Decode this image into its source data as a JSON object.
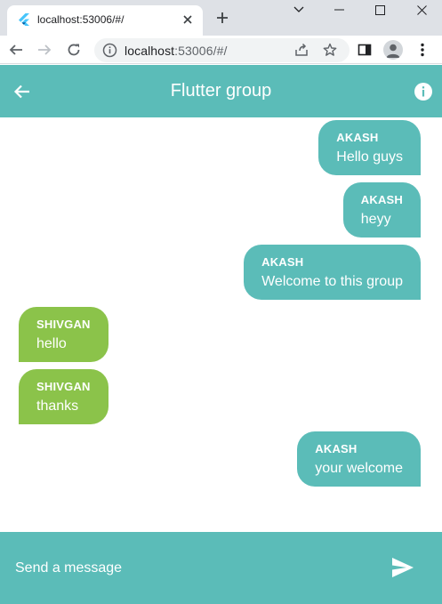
{
  "browser": {
    "tab_title": "localhost:53006/#/",
    "url_host": "localhost",
    "url_rest": ":53006/#/"
  },
  "app": {
    "title": "Flutter group",
    "accent": "#5bbcb8",
    "incoming_color": "#8bc34a"
  },
  "messages": [
    {
      "sender": "AKASH",
      "text": "Hello guys",
      "mine": true
    },
    {
      "sender": "AKASH",
      "text": "heyy",
      "mine": true
    },
    {
      "sender": "AKASH",
      "text": "Welcome to this group",
      "mine": true
    },
    {
      "sender": "SHIVGAN",
      "text": "hello",
      "mine": false
    },
    {
      "sender": "SHIVGAN",
      "text": "thanks",
      "mine": false
    },
    {
      "sender": "AKASH",
      "text": "your welcome",
      "mine": true
    }
  ],
  "composer": {
    "placeholder": "Send a message"
  }
}
